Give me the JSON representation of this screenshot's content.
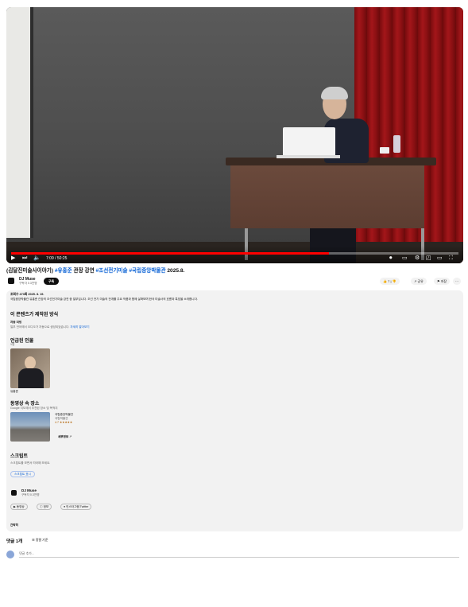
{
  "player": {
    "time": "7:09 / 50:25",
    "progress_fraction": 0.71
  },
  "video": {
    "title_prefix": "(김달진미술사이야기) ",
    "title_tag1": "#유홍준",
    "title_mid": " 관장 강연 ",
    "title_tag2": "#조선전기미술",
    "title_sp": " ",
    "title_tag3": "#국립중앙박물관",
    "title_suffix": " 2025.8."
  },
  "channel": {
    "name": "DJ Muse",
    "subscribers": "구독자 0.3천명",
    "subscribe_label": "구독"
  },
  "actions": {
    "like_count": "7",
    "share": "공유",
    "save": "저장",
    "more": "···"
  },
  "description": {
    "meta": "조회수 473회  2025. 8. 19.",
    "text": "국립중앙박물관 유홍준 관장의 조선전기미술 강연 중 일부입니다. 조선 전기 미술의 전개를 주요 작품과 함께 살펴보며 한국 미술사의 흐름과 특징을 소개합니다.",
    "made_heading": "이 콘텐츠가 제작된 방식",
    "made_label": "자동 더빙",
    "made_text": "일부 언어에서 오디오가 자동으로 생성되었습니다. ",
    "made_link": "자세히 알아보기",
    "people_heading": "언급된 인물",
    "people_sub": "1명",
    "person_name": "유홍준",
    "place_heading": "동영상 속 장소",
    "place_sub": "Google 지도에서 추천된 장소 및 목적지",
    "place_name": "국립중앙박물관",
    "place_category": "국립박물관",
    "place_rating": "4.7 ★★★★★",
    "place_details": "세부정보",
    "script_heading": "스크립트",
    "script_text": "스크립트를 보면서 따라해 보세요.",
    "script_button": "스크립트 표시",
    "footer_channel": "DJ Muse",
    "footer_subs": "구독자 0.3천명",
    "btn_videos": "동영상",
    "btn_info": "정보",
    "btn_twitter": "인스타그램 Twitter",
    "less": "간략히"
  },
  "comments": {
    "count_label": "댓글 1개",
    "sort_label": "정렬 기준",
    "input_placeholder": "댓글 추가..."
  },
  "colors": {
    "accent_blue": "#065fd4",
    "progress_red": "#ff0000"
  }
}
